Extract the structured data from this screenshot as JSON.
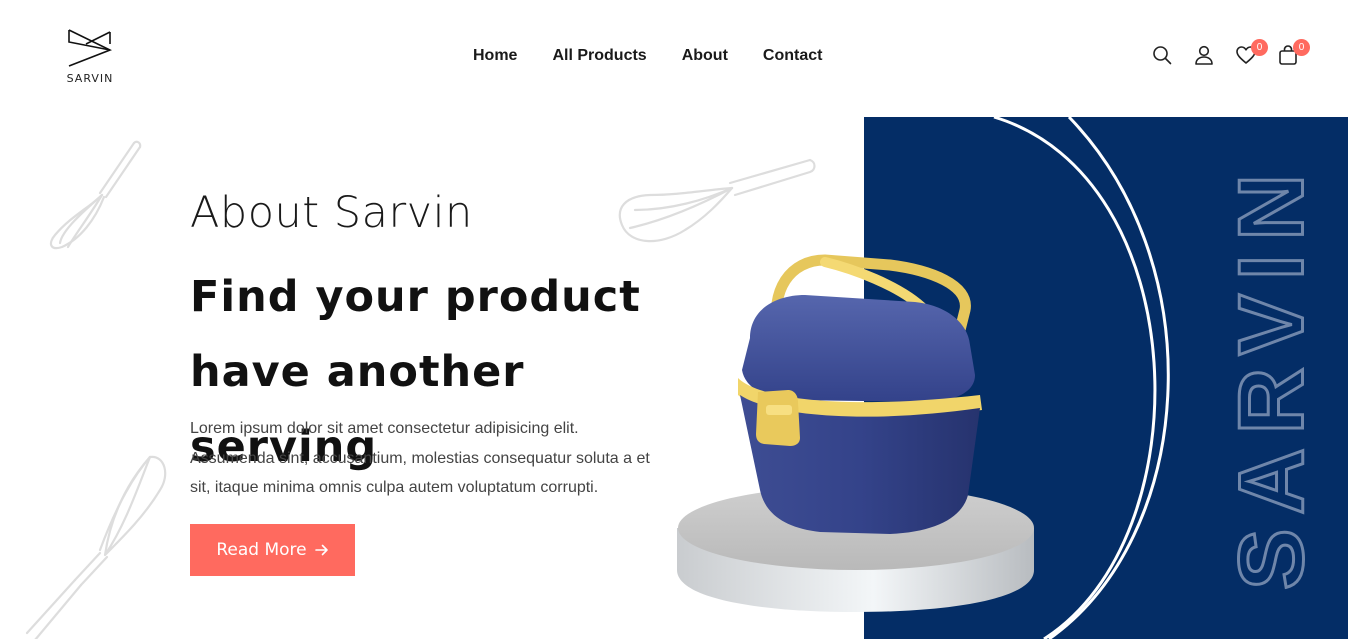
{
  "brand": {
    "name": "SARVIN"
  },
  "nav": {
    "items": [
      {
        "label": "Home"
      },
      {
        "label": "All Products"
      },
      {
        "label": "About"
      },
      {
        "label": "Contact"
      }
    ]
  },
  "header_icons": {
    "search": "search-icon",
    "account": "user-icon",
    "wishlist": {
      "icon": "heart-icon",
      "count": "0"
    },
    "cart": {
      "icon": "bag-icon",
      "count": "0"
    }
  },
  "hero": {
    "subtitle": "About Sarvin",
    "headline_line1": "Find your product",
    "headline_line2": "have another serving",
    "paragraph": "Lorem ipsum dolor sit amet consectetur adipisicing elit. Assumenda sint, accusantium, molestias consequatur soluta a et sit, itaque minima omnis culpa autem voluptatum corrupti.",
    "button_label": "Read More",
    "button_icon": "arrow-right-icon"
  },
  "side_art": {
    "vertical_text": "SARVIN"
  },
  "colors": {
    "accent": "#ff6a5f",
    "panel_blue": "#042d66",
    "text_dark": "#111111",
    "text_body": "#444444"
  }
}
